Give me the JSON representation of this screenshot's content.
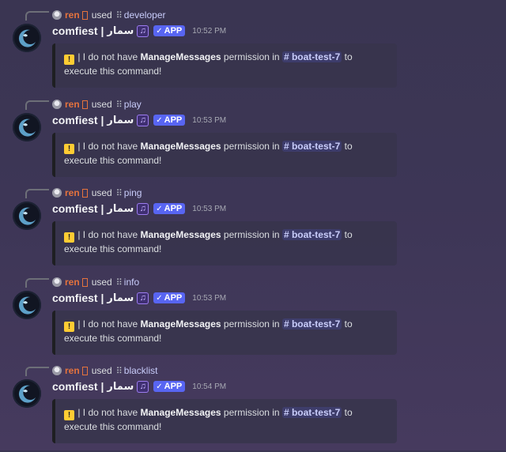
{
  "messages": [
    {
      "reply_user": "ren",
      "reply_used": "used",
      "command": "developer",
      "username": "comfiest |",
      "username_rtl": "سمار",
      "badge": "APP",
      "timestamp": "10:52 PM",
      "embed": {
        "pre": " | I do not have ",
        "bold": "ManageMessages",
        "mid": " permission in ",
        "channel": "# boat-test-7",
        "post": " to execute this command!"
      }
    },
    {
      "reply_user": "ren",
      "reply_used": "used",
      "command": "play",
      "username": "comfiest |",
      "username_rtl": "سمار",
      "badge": "APP",
      "timestamp": "10:53 PM",
      "embed": {
        "pre": " | I do not have ",
        "bold": "ManageMessages",
        "mid": " permission in ",
        "channel": "# boat-test-7",
        "post": " to execute this command!"
      }
    },
    {
      "reply_user": "ren",
      "reply_used": "used",
      "command": "ping",
      "username": "comfiest |",
      "username_rtl": "سمار",
      "badge": "APP",
      "timestamp": "10:53 PM",
      "embed": {
        "pre": " | I do not have ",
        "bold": "ManageMessages",
        "mid": " permission in ",
        "channel": "# boat-test-7",
        "post": " to execute this command!"
      }
    },
    {
      "reply_user": "ren",
      "reply_used": "used",
      "command": "info",
      "username": "comfiest |",
      "username_rtl": "سمار",
      "badge": "APP",
      "timestamp": "10:53 PM",
      "embed": {
        "pre": " | I do not have ",
        "bold": "ManageMessages",
        "mid": " permission in ",
        "channel": "# boat-test-7",
        "post": " to execute this command!"
      }
    },
    {
      "reply_user": "ren",
      "reply_used": "used",
      "command": "blacklist",
      "username": "comfiest |",
      "username_rtl": "سمار",
      "badge": "APP",
      "timestamp": "10:54 PM",
      "embed": {
        "pre": " | I do not have ",
        "bold": "ManageMessages",
        "mid": " permission in ",
        "channel": "# boat-test-7",
        "post": " to execute this command!"
      }
    }
  ],
  "icons": {
    "command": "slash-command-icon",
    "music": "music-note-icon",
    "check": "checkmark-icon",
    "warning": "warning-icon"
  },
  "colors": {
    "app_badge": "#5865f2",
    "reply_user": "#e5733d",
    "mention": "#c9cdfb",
    "warning": "#ffcc33"
  }
}
